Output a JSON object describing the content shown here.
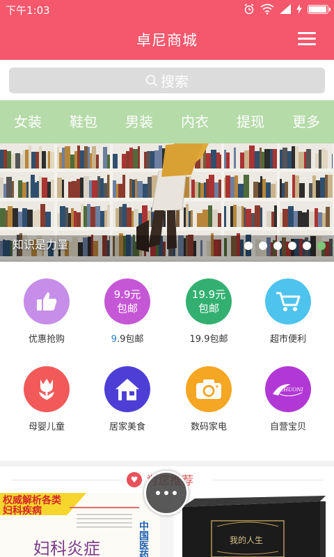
{
  "status": {
    "time": "下午1:03",
    "battery_level": 0.9
  },
  "header": {
    "title": "卓尼商城"
  },
  "search": {
    "label": "搜索"
  },
  "categories": [
    "女装",
    "鞋包",
    "男装",
    "内衣",
    "提现",
    "更多"
  ],
  "banner": {
    "caption": "知识是力量",
    "slide_count": 6,
    "active_index": 5
  },
  "grid": [
    {
      "label": "优惠抢购",
      "circle_text": [],
      "color": "#c68ee8",
      "icon": "thumbs-up-icon"
    },
    {
      "label_prefix": "9",
      "label_rest": ".9包邮",
      "circle_text": [
        "9.9元",
        "包邮"
      ],
      "color": "#c557d6",
      "icon": ""
    },
    {
      "label": "19.9包邮",
      "circle_text": [
        "19.9元",
        "包邮"
      ],
      "color": "#33b071",
      "icon": ""
    },
    {
      "label": "超市便利",
      "circle_text": [],
      "color": "#4ec3ee",
      "icon": "shopping-cart-icon"
    },
    {
      "label": "母婴儿童",
      "circle_text": [],
      "color": "#f25a5a",
      "icon": "tulip-icon"
    },
    {
      "label": "居家美食",
      "circle_text": [],
      "color": "#4d3fd6",
      "icon": "house-icon"
    },
    {
      "label": "数码家电",
      "circle_text": [],
      "color": "#f5a623",
      "icon": "camera-icon"
    },
    {
      "label": "自营宝贝",
      "circle_text": [],
      "color": "#b238d6",
      "icon": "zhuoni-logo-icon",
      "logo_text": "ZHUONI"
    }
  ],
  "recommend": {
    "title": "为您推荐"
  },
  "products": [
    {
      "headline_1": "权威解析各类",
      "headline_2": "妇科疾病",
      "title": "妇科炎症",
      "side_text": "中国医药科"
    },
    {
      "title": "我的人生"
    }
  ],
  "colors": {
    "brand": "#f5576c",
    "category_bar": "#b5dba8",
    "search_box": "#dcdcdc",
    "active_dot": "#7cc576"
  }
}
